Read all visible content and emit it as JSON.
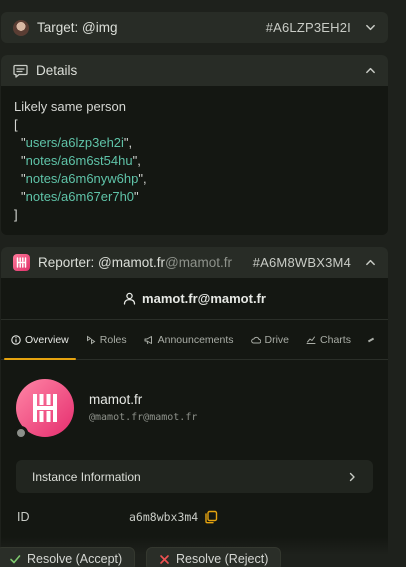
{
  "target_panel": {
    "title": "Target: @img",
    "code": "#A6LZP3EH2I"
  },
  "details_panel": {
    "title": "Details",
    "comment": "Likely same person",
    "open_bracket": "[",
    "close_bracket": "]",
    "items": [
      "users/a6lzp3eh2i",
      "notes/a6m6st54hu",
      "notes/a6m6nyw6hp",
      "notes/a6m67er7h0"
    ]
  },
  "reporter_panel": {
    "label": "Reporter: @mamot.fr",
    "label_suffix": "@mamot.fr",
    "code": "#A6M8WBX3M4",
    "user_title": "mamot.fr@mamot.fr",
    "tabs": [
      {
        "label": "Overview",
        "icon": "info-icon",
        "active": true
      },
      {
        "label": "Roles",
        "icon": "badges-icon"
      },
      {
        "label": "Announcements",
        "icon": "megaphone-icon"
      },
      {
        "label": "Drive",
        "icon": "cloud-icon"
      },
      {
        "label": "Charts",
        "icon": "chart-line-icon"
      }
    ],
    "instance_name": "mamot.fr",
    "instance_handle": "@mamot.fr@mamot.fr",
    "instance_info_label": "Instance Information",
    "id_label": "ID",
    "id_value": "a6m8wbx3m4"
  },
  "actions": {
    "accept_label": "Resolve (Accept)",
    "reject_label": "Resolve (Reject)"
  },
  "colors": {
    "accent": "#e5a30f",
    "json_string": "#5fc3a8",
    "brand_gradient_start": "#ff86a6",
    "brand_gradient_end": "#e52d6e",
    "accept_icon": "#7ec86e",
    "reject_icon": "#f05252"
  }
}
